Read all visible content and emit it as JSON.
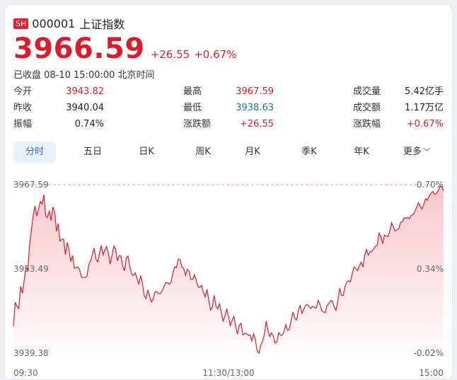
{
  "header": {
    "market_badge": "SH",
    "code": "000001",
    "name": "上证指数"
  },
  "quote": {
    "price": "3966.59",
    "change": "+26.55",
    "change_pct": "+0.67%",
    "status": "已收盘 08-10 15:00:00 北京时间"
  },
  "stats": [
    {
      "label": "今开",
      "value": "3943.82",
      "tone": "red"
    },
    {
      "label": "最高",
      "value": "3967.59",
      "tone": "red"
    },
    {
      "label": "成交量",
      "value": "5.42亿手",
      "tone": "dark"
    },
    {
      "label": "昨收",
      "value": "3940.04",
      "tone": "dark"
    },
    {
      "label": "最低",
      "value": "3938.63",
      "tone": "green"
    },
    {
      "label": "成交额",
      "value": "1.17万亿",
      "tone": "dark"
    },
    {
      "label": "振幅",
      "value": "0.74%",
      "tone": "dark"
    },
    {
      "label": "涨跌额",
      "value": "+26.55",
      "tone": "red"
    },
    {
      "label": "涨跌幅",
      "value": "+0.67%",
      "tone": "red"
    }
  ],
  "tabs": [
    {
      "label": "分时",
      "active": true
    },
    {
      "label": "五日",
      "active": false
    },
    {
      "label": "日K",
      "active": false
    },
    {
      "label": "周K",
      "active": false
    },
    {
      "label": "月K",
      "active": false
    },
    {
      "label": "季K",
      "active": false
    },
    {
      "label": "年K",
      "active": false
    },
    {
      "label": "更多",
      "active": false
    }
  ],
  "colors": {
    "up": "#d81e2d",
    "down": "#12876f",
    "accent": "#2f6fde"
  },
  "chart_data": {
    "type": "area",
    "y_left_ticks": [
      "3967.59",
      "3953.49",
      "3939.38"
    ],
    "y_right_ticks": [
      "0.70%",
      "0.34%",
      "-0.02%"
    ],
    "x_ticks": [
      "09:30",
      "11:30/13:00",
      "15:00"
    ],
    "ylim": [
      3939.38,
      3967.59
    ],
    "reference_line": 3967.59,
    "points": 241,
    "values": [
      3943.82,
      3948.0,
      3946.0,
      3950.5,
      3949.0,
      3955.0,
      3952.0,
      3958.0,
      3962.0,
      3964.0,
      3962.5,
      3965.0,
      3963.0,
      3966.5,
      3961.0,
      3963.5,
      3962.0,
      3964.5,
      3959.0,
      3962.0,
      3957.0,
      3959.5,
      3956.0,
      3957.5,
      3955.0,
      3956.5,
      3952.5,
      3954.5,
      3953.0,
      3951.0,
      3953.5,
      3952.0,
      3954.0,
      3955.5,
      3956.5,
      3955.0,
      3956.0,
      3957.0,
      3955.5,
      3957.5,
      3956.0,
      3955.0,
      3957.0,
      3956.5,
      3955.0,
      3956.0,
      3954.5,
      3954.0,
      3955.5,
      3954.0,
      3953.0,
      3952.0,
      3953.5,
      3951.0,
      3951.5,
      3950.0,
      3948.5,
      3950.0,
      3949.0,
      3947.5,
      3949.0,
      3950.5,
      3949.0,
      3950.0,
      3951.5,
      3950.0,
      3951.0,
      3952.5,
      3953.5,
      3954.0,
      3955.5,
      3953.0,
      3954.5,
      3952.5,
      3953.5,
      3952.0,
      3951.0,
      3952.5,
      3951.5,
      3950.0,
      3950.5,
      3948.5,
      3949.5,
      3948.0,
      3947.0,
      3948.5,
      3946.5,
      3947.5,
      3946.0,
      3945.5,
      3946.5,
      3945.0,
      3944.0,
      3945.5,
      3944.5,
      3943.0,
      3944.0,
      3942.5,
      3943.0,
      3942.0,
      3943.5,
      3941.0,
      3942.0,
      3940.5,
      3939.0,
      3941.5,
      3942.5,
      3944.0,
      3942.0,
      3943.5,
      3942.0,
      3941.0,
      3942.5,
      3941.5,
      3943.0,
      3944.5,
      3943.0,
      3944.0,
      3945.5,
      3945.0,
      3946.0,
      3947.5,
      3946.0,
      3947.0,
      3946.5,
      3948.0,
      3947.5,
      3946.5,
      3947.0,
      3948.0,
      3946.5,
      3947.5,
      3946.0,
      3947.0,
      3948.5,
      3947.5,
      3947.0,
      3948.0,
      3949.5,
      3948.5,
      3950.0,
      3951.0,
      3952.5,
      3951.5,
      3953.0,
      3954.0,
      3953.0,
      3955.0,
      3954.5,
      3956.0,
      3955.5,
      3957.0,
      3956.0,
      3958.0,
      3957.5,
      3959.0,
      3958.0,
      3959.5,
      3958.5,
      3960.0,
      3960.5,
      3959.5,
      3961.0,
      3960.0,
      3961.5,
      3962.0,
      3961.0,
      3962.5,
      3963.0,
      3962.0,
      3963.5,
      3964.0,
      3963.5,
      3964.5,
      3965.0,
      3964.5,
      3966.0,
      3965.5,
      3966.5,
      3967.0,
      3966.0,
      3967.59,
      3966.59
    ]
  }
}
